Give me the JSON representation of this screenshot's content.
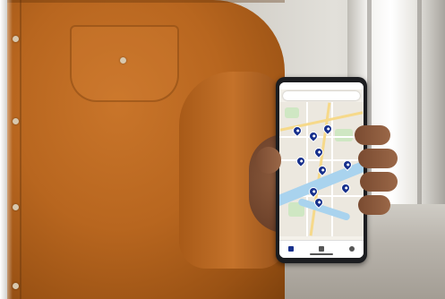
{
  "photo": {
    "subject": "",
    "colors": {
      "shirt": "#b8661f",
      "skin": "#6b4029",
      "phone_body": "#1c1d20",
      "map_background": "#ece8df",
      "map_pin": "#17308c",
      "river": "#a9d3ee"
    }
  },
  "phone": {
    "status_time": "",
    "map": {
      "pin_icon": "map-pin-icon",
      "pin_count": 10
    },
    "bottom_nav": {
      "icons": [
        "home-icon",
        "list-icon",
        "profile-icon"
      ]
    }
  }
}
